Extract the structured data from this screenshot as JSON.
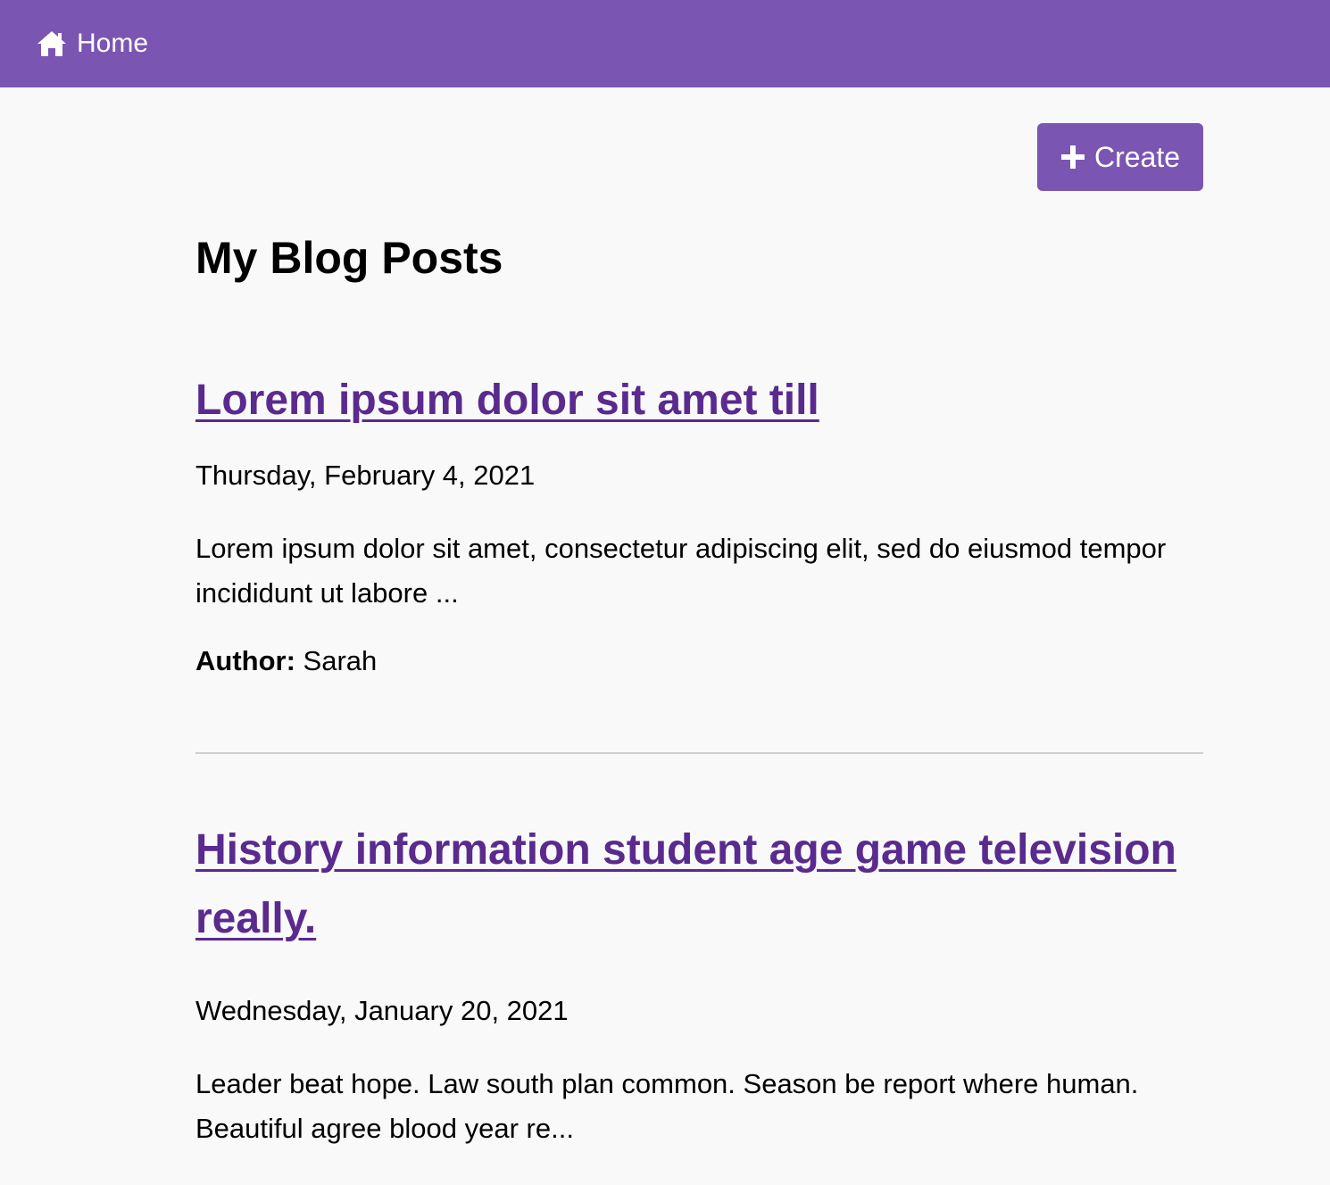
{
  "navbar": {
    "home_label": "Home",
    "home_icon": "home-icon",
    "background_color": "#7b55b2"
  },
  "toolbar": {
    "create_label": "Create",
    "create_icon": "plus-icon"
  },
  "page": {
    "title": "My Blog Posts"
  },
  "posts": [
    {
      "title": "Lorem ipsum dolor sit amet till",
      "date": "Thursday, February 4, 2021",
      "excerpt": "Lorem ipsum dolor sit amet, consectetur adipiscing elit, sed do eiusmod tempor incididunt ut labore ...",
      "author_label": "Author:",
      "author": "Sarah"
    },
    {
      "title": "History information student age game television really.",
      "date": "Wednesday, January 20, 2021",
      "excerpt": "Leader beat hope. Law south plan common. Season be report where human. Beautiful agree blood year re..."
    }
  ],
  "colors": {
    "accent": "#7b55b2",
    "link": "#5a2a8e",
    "background": "#f9f9f9"
  }
}
